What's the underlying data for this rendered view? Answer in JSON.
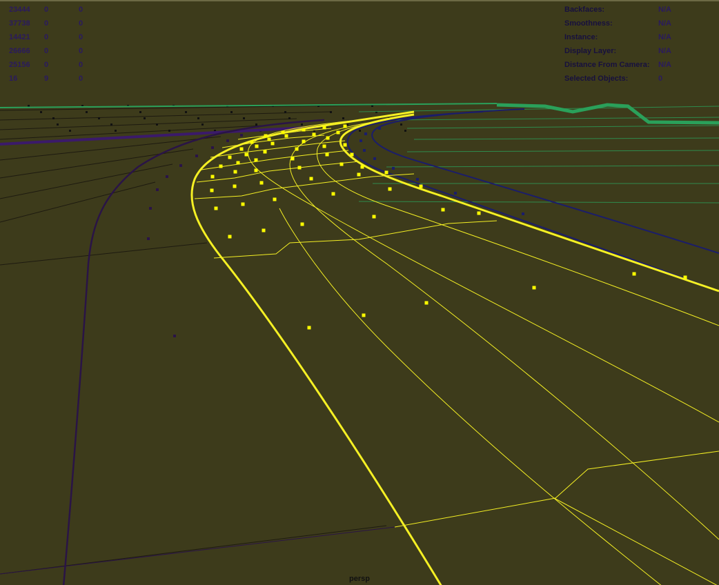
{
  "viewport": {
    "camera": "persp",
    "colors": {
      "background": "#3d3b1b",
      "selected_wire": "#f5f024",
      "selected_vertex": "#ffff00",
      "unselected_wire": "#2a1446",
      "inner_wire": "#1b1d6a",
      "grid_lines": "#1d1a10",
      "far_mesh": "#2aa05a"
    }
  },
  "stats_hud": {
    "rows": [
      [
        "23444",
        "0",
        "0"
      ],
      [
        "37738",
        "0",
        "0"
      ],
      [
        "14421",
        "0",
        "0"
      ],
      [
        "26666",
        "0",
        "0"
      ],
      [
        "25156",
        "0",
        "0"
      ],
      [
        "16",
        "9",
        "0"
      ]
    ]
  },
  "info_hud": {
    "rows": [
      {
        "label": "Backfaces:",
        "value": "N/A"
      },
      {
        "label": "Smoothness:",
        "value": "N/A"
      },
      {
        "label": "Instance:",
        "value": "N/A"
      },
      {
        "label": "Display Layer:",
        "value": "N/A"
      },
      {
        "label": "Distance From Camera:",
        "value": "N/A"
      },
      {
        "label": "Selected Objects:",
        "value": "0"
      }
    ]
  }
}
